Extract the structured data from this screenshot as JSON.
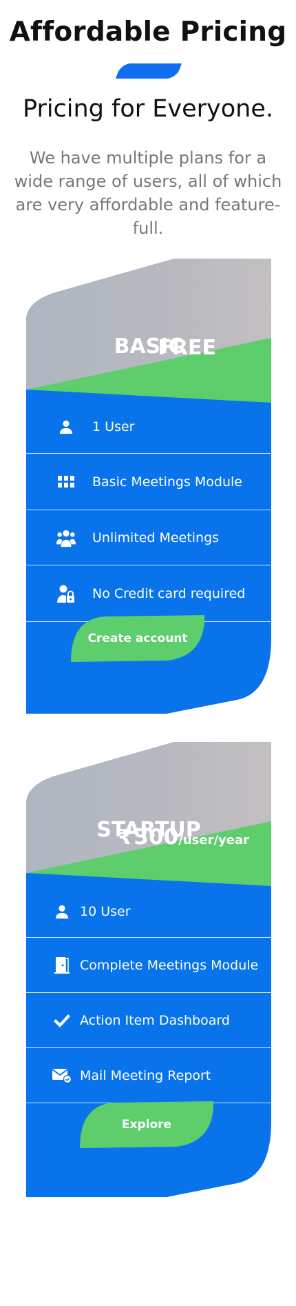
{
  "hero": {
    "title": "Affordable Pricing",
    "subtitle": "Pricing for Everyone.",
    "description": "We have multiple plans for a wide range of users, all of which are very affordable and feature-full."
  },
  "colors": {
    "primary": "#0873ea",
    "accent_green": "#5ecd6c",
    "header_gray": "#b9b9bf"
  },
  "plans": [
    {
      "name": "BASIC",
      "price": "FREE",
      "features": [
        {
          "icon": "user-icon",
          "label": "1 User"
        },
        {
          "icon": "grid-icon",
          "label": "Basic Meetings Module"
        },
        {
          "icon": "users-group-icon",
          "label": "Unlimited Meetings"
        },
        {
          "icon": "user-lock-icon",
          "label": "No Credit card required"
        }
      ],
      "cta_label": "Create account"
    },
    {
      "name": "STARTUP",
      "price_symbol": "₹",
      "price_amount": "300",
      "price_unit": "/user/year",
      "features": [
        {
          "icon": "user-icon",
          "label": "10 User"
        },
        {
          "icon": "door-icon",
          "label": "Complete Meetings Module"
        },
        {
          "icon": "checkmark-icon",
          "label": "Action Item Dashboard"
        },
        {
          "icon": "mail-check-icon",
          "label": "Mail Meeting Report"
        }
      ],
      "cta_label": "Explore"
    }
  ]
}
